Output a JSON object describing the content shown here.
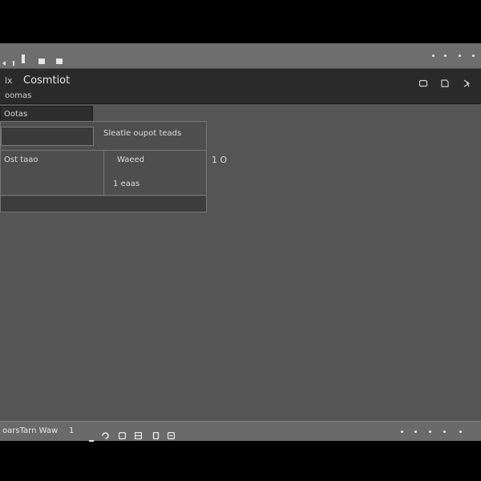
{
  "window": {
    "controls": [
      "back-icon",
      "forward-icon",
      "stop-icon",
      "reload-icon"
    ],
    "right_icons": [
      "dot-icon",
      "dot-icon",
      "dot-icon",
      "dot-icon"
    ]
  },
  "header": {
    "icon_label": "lx",
    "title": "Cosmtiot",
    "subtitle": "oomas",
    "buttons": [
      "window-icon",
      "clipboard-icon",
      "pin-icon"
    ]
  },
  "main": {
    "tab_label": "Ootas",
    "panel": {
      "input_value": "",
      "heading": "Sleatle oupot teads",
      "left_cell": "Ost taao",
      "right_cell_top": "Waeed",
      "right_cell_bottom": "1 eaas"
    },
    "side_marker": "1 O"
  },
  "statusbar": {
    "text": "oarsTarn Waw",
    "separator": "1",
    "icons": [
      "refresh-icon",
      "cloud-icon",
      "grid-icon",
      "lock-icon",
      "doc-icon"
    ],
    "right_icons": [
      "dot-icon",
      "dot-icon",
      "dot-icon",
      "dot-icon",
      "dot-icon"
    ]
  }
}
